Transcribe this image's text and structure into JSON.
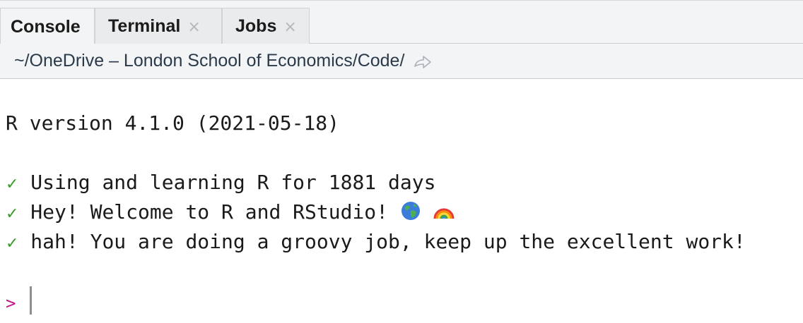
{
  "tabs": [
    {
      "label": "Console",
      "active": true,
      "closable": false
    },
    {
      "label": "Terminal",
      "active": false,
      "closable": true
    },
    {
      "label": "Jobs",
      "active": false,
      "closable": true
    }
  ],
  "tab_close_glyph": "×",
  "path": {
    "text": "~/OneDrive – London School of Economics/Code/",
    "goto_icon": "arrow-forward-icon"
  },
  "console": {
    "version_line": "R version 4.1.0 (2021-05-18)",
    "check_glyph": "✓",
    "messages": [
      "Using and learning R for 1881 days",
      "Hey! Welcome to R and RStudio!",
      "hah! You are doing a groovy job, keep up the excellent work!"
    ],
    "emojis": [
      "globe-emoji",
      "rainbow-emoji"
    ],
    "prompt": ">"
  },
  "colors": {
    "check": "#3a9a2a",
    "prompt": "#c3128a",
    "tab_bg": "#f3f4f5"
  }
}
